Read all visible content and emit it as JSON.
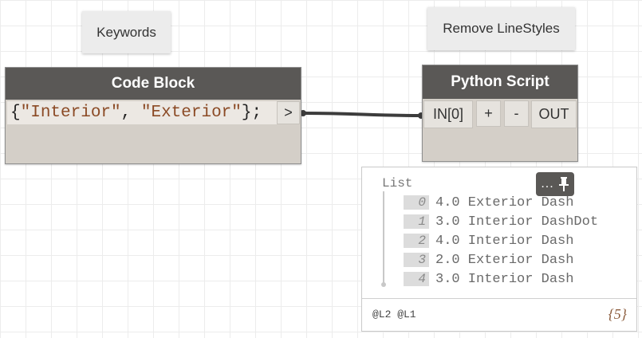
{
  "notes": {
    "keywords": "Keywords",
    "remove_linestyles": "Remove LineStyles"
  },
  "code_block_node": {
    "title": "Code Block",
    "code_open": "{",
    "code_str1": "\"Interior\"",
    "code_sep": ", ",
    "code_str2": "\"Exterior\"",
    "code_close": "};",
    "output_port": ">"
  },
  "python_node": {
    "title": "Python Script",
    "input_port": "IN[0]",
    "add_input": "+",
    "remove_input": "-",
    "output_port": "OUT"
  },
  "preview": {
    "list_label": "List",
    "pin_label": "...",
    "items": [
      {
        "index": "0",
        "value": "4.0 Exterior Dash"
      },
      {
        "index": "1",
        "value": "3.0 Interior DashDot"
      },
      {
        "index": "2",
        "value": "4.0 Interior Dash"
      },
      {
        "index": "3",
        "value": "2.0 Exterior Dash"
      },
      {
        "index": "4",
        "value": "3.0 Interior Dash"
      }
    ],
    "levels": "@L2 @L1",
    "count": "{5}"
  },
  "colors": {
    "node_header": "#5a5856",
    "node_body": "#d4cfc8",
    "wire": "#3c3c3c",
    "string_literal": "#8b4a25"
  },
  "icons": {
    "pin": "pin-icon"
  }
}
